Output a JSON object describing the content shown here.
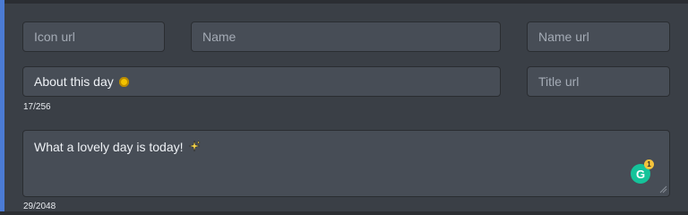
{
  "form": {
    "icon_url": {
      "placeholder": "Icon url"
    },
    "name": {
      "placeholder": "Name"
    },
    "name_url": {
      "placeholder": "Name url"
    },
    "about": {
      "value": "About this day",
      "emoji_icon": "sun-emoji-icon",
      "counter": "17/256"
    },
    "title_url": {
      "placeholder": "Title url"
    },
    "description": {
      "value": "What a lovely day is today!",
      "emoji_icon": "sparkles-emoji-icon",
      "counter": "29/2048"
    }
  },
  "grammarly": {
    "letter": "G",
    "badge_count": "1"
  },
  "colors": {
    "accent": "#4b7bd4",
    "panel": "#3a3f46",
    "field": "#474d56",
    "grammarly": "#15c39a"
  }
}
